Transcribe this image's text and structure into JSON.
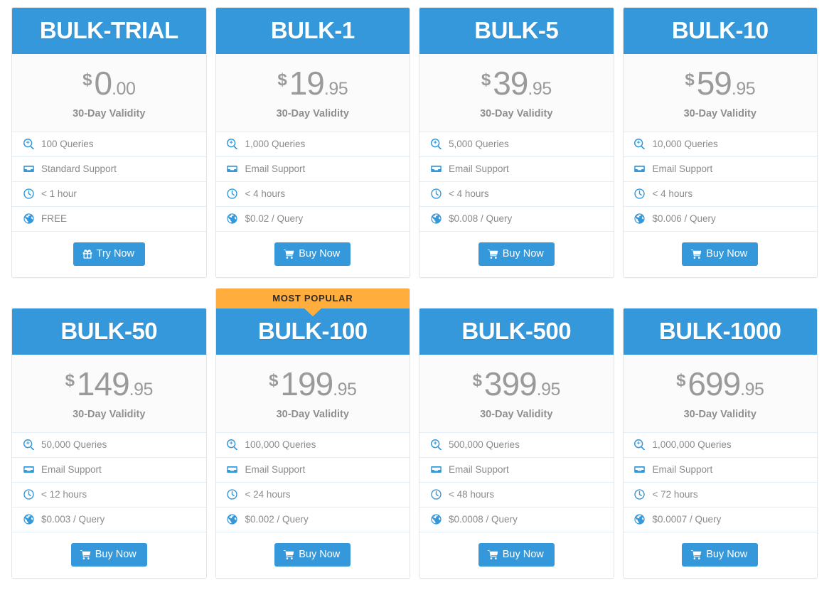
{
  "theme": {
    "accent": "#3498db",
    "popular_badge": "#ffad3d",
    "price_text": "#9a9a9a",
    "feature_text": "#8b8b8b",
    "divider": "#e3eef7",
    "card_border": "#e4e4e4",
    "price_bg": "#fbfbfb"
  },
  "badges": {
    "most_popular": "MOST POPULAR"
  },
  "validity_label": "30-Day Validity",
  "cta": {
    "try": {
      "label": "Try Now",
      "icon": "gift-icon"
    },
    "buy": {
      "label": "Buy Now",
      "icon": "shopping-cart-icon"
    }
  },
  "feature_icons": [
    "search-plus-icon",
    "inbox-icon",
    "clock-icon",
    "globe-icon"
  ],
  "plans": [
    {
      "name": "BULK-TRIAL",
      "currency": "$",
      "price_int": "0",
      "price_dec": ".00",
      "validity": "30-Day Validity",
      "popular": false,
      "features": [
        "100 Queries",
        "Standard Support",
        "< 1 hour",
        "FREE"
      ],
      "cta_label": "Try Now",
      "cta_icon": "gift-icon"
    },
    {
      "name": "BULK-1",
      "currency": "$",
      "price_int": "19",
      "price_dec": ".95",
      "validity": "30-Day Validity",
      "popular": false,
      "features": [
        "1,000 Queries",
        "Email Support",
        "< 4 hours",
        "$0.02 / Query"
      ],
      "cta_label": "Buy Now",
      "cta_icon": "shopping-cart-icon"
    },
    {
      "name": "BULK-5",
      "currency": "$",
      "price_int": "39",
      "price_dec": ".95",
      "validity": "30-Day Validity",
      "popular": false,
      "features": [
        "5,000 Queries",
        "Email Support",
        "< 4 hours",
        "$0.008 / Query"
      ],
      "cta_label": "Buy Now",
      "cta_icon": "shopping-cart-icon"
    },
    {
      "name": "BULK-10",
      "currency": "$",
      "price_int": "59",
      "price_dec": ".95",
      "validity": "30-Day Validity",
      "popular": false,
      "features": [
        "10,000 Queries",
        "Email Support",
        "< 4 hours",
        "$0.006 / Query"
      ],
      "cta_label": "Buy Now",
      "cta_icon": "shopping-cart-icon"
    },
    {
      "name": "BULK-50",
      "currency": "$",
      "price_int": "149",
      "price_dec": ".95",
      "validity": "30-Day Validity",
      "popular": false,
      "features": [
        "50,000 Queries",
        "Email Support",
        "< 12 hours",
        "$0.003 / Query"
      ],
      "cta_label": "Buy Now",
      "cta_icon": "shopping-cart-icon"
    },
    {
      "name": "BULK-100",
      "currency": "$",
      "price_int": "199",
      "price_dec": ".95",
      "validity": "30-Day Validity",
      "popular": true,
      "badge": "MOST POPULAR",
      "features": [
        "100,000 Queries",
        "Email Support",
        "< 24 hours",
        "$0.002 / Query"
      ],
      "cta_label": "Buy Now",
      "cta_icon": "shopping-cart-icon"
    },
    {
      "name": "BULK-500",
      "currency": "$",
      "price_int": "399",
      "price_dec": ".95",
      "validity": "30-Day Validity",
      "popular": false,
      "features": [
        "500,000 Queries",
        "Email Support",
        "< 48 hours",
        "$0.0008 / Query"
      ],
      "cta_label": "Buy Now",
      "cta_icon": "shopping-cart-icon"
    },
    {
      "name": "BULK-1000",
      "currency": "$",
      "price_int": "699",
      "price_dec": ".95",
      "validity": "30-Day Validity",
      "popular": false,
      "features": [
        "1,000,000 Queries",
        "Email Support",
        "< 72 hours",
        "$0.0007 / Query"
      ],
      "cta_label": "Buy Now",
      "cta_icon": "shopping-cart-icon"
    }
  ]
}
